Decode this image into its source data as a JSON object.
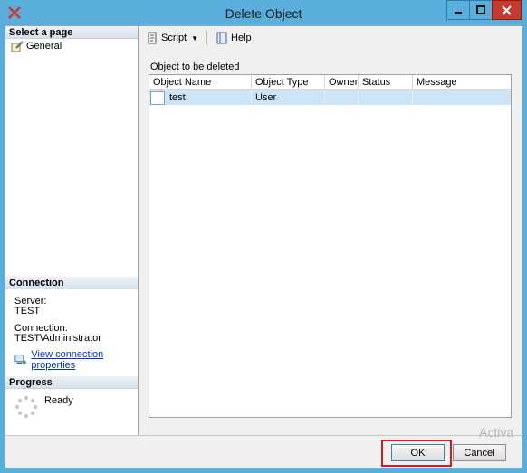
{
  "window": {
    "title": "Delete Object"
  },
  "left_pane": {
    "select_page_heading": "Select a page",
    "pages": [
      {
        "label": "General",
        "icon": "wrench-page-icon"
      }
    ],
    "connection": {
      "heading": "Connection",
      "server_label": "Server:",
      "server_value": "TEST",
      "connection_label": "Connection:",
      "connection_value": "TEST\\Administrator",
      "view_properties_link": "View connection properties"
    },
    "progress": {
      "heading": "Progress",
      "status": "Ready"
    }
  },
  "toolbar": {
    "script_label": "Script",
    "help_label": "Help"
  },
  "objects": {
    "caption": "Object to be deleted",
    "columns": [
      "Object Name",
      "Object Type",
      "Owner",
      "Status",
      "Message"
    ],
    "rows": [
      {
        "name": "test",
        "type": "User",
        "owner": "",
        "status": "",
        "message": ""
      }
    ]
  },
  "buttons": {
    "ok": "OK",
    "cancel": "Cancel"
  },
  "watermark": "Activa",
  "colors": {
    "titlebar": "#5aaedb",
    "close": "#c7392f",
    "selected_row": "#cde4f7",
    "highlight": "#d01c1c",
    "link": "#0033cc"
  }
}
